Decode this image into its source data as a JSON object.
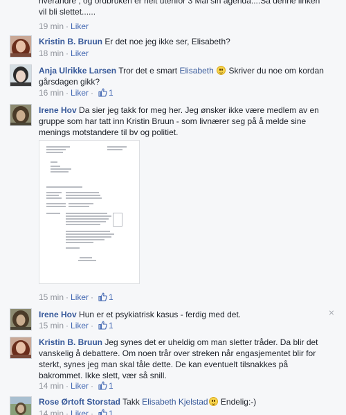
{
  "comments": [
    {
      "text": "hverandre , og ordbruken er helt utenfor 3 Mai sin agenda....Så denne linken vil bli slettet......",
      "time": "19 min",
      "like_label": "Liker"
    },
    {
      "author": "Kristin B. Bruun",
      "text": "Er det noe jeg ikke ser, Elisabeth?",
      "time": "18 min",
      "like_label": "Liker"
    },
    {
      "author": "Anja Ulrikke Larsen",
      "text_before": "Tror det e smart",
      "mention": "Elisabeth",
      "text_after": "Skriver du noe om kordan gårsdagen gikk?",
      "time": "16 min",
      "like_label": "Liker",
      "like_count": "1"
    },
    {
      "author": "Irene Hov",
      "text": "Da sier jeg takk for meg her. Jeg ønsker ikke være medlem av en gruppe som har tatt inn Kristin Bruun - som livnærer seg på å melde sine menings motstandere til bv og politiet.",
      "time": "15 min",
      "like_label": "Liker",
      "like_count": "1"
    },
    {
      "author": "Irene Hov",
      "text": "Hun er et psykiatrisk kasus - ferdig med det.",
      "time": "15 min",
      "like_label": "Liker",
      "like_count": "1"
    },
    {
      "author": "Kristin B. Bruun",
      "text": "Jeg synes det er uheldig om man sletter tråder. Da blir det vanskelig å debattere. Om noen trår over streken når engasjementet blir for sterkt, synes jeg man skal tåle dette. De kan eventuelt tilsnakkes på bakrommet. Ikke slett, vær så snill.",
      "time": "14 min",
      "like_label": "Liker",
      "like_count": "1"
    },
    {
      "author": "Rose Ørtoft Storstad",
      "text_before": "Takk",
      "mention": "Elisabeth Kjelstad",
      "text_after": "Endelig:-)",
      "time": "14 min",
      "like_label": "Liker",
      "like_count": "1"
    }
  ],
  "close_symbol": "×",
  "colors": {
    "name": "#365899",
    "meta": "#90949c",
    "like": "#4267b2",
    "background": "#f6f7f9"
  }
}
